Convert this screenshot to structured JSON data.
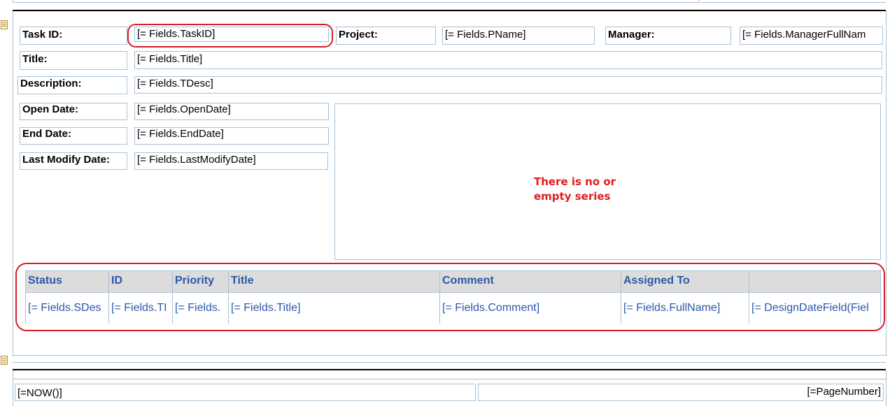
{
  "fields": {
    "task_id_label": "Task ID:",
    "task_id_value": "[= Fields.TaskID]",
    "project_label": "Project:",
    "project_value": "[= Fields.PName]",
    "manager_label": "Manager:",
    "manager_value": "[= Fields.ManagerFullNam",
    "title_label": "Title:",
    "title_value": "[= Fields.Title]",
    "description_label": "Description:",
    "description_value": "[= Fields.TDesc]",
    "open_date_label": "Open Date:",
    "open_date_value": "[= Fields.OpenDate]",
    "end_date_label": "End Date:",
    "end_date_value": "[= Fields.EndDate]",
    "last_modify_label": "Last Modify Date:",
    "last_modify_value": "[= Fields.LastModifyDate]"
  },
  "chart_placeholder": {
    "line1": "There is no or",
    "line2": "empty series"
  },
  "table": {
    "headers": [
      "Status",
      "ID",
      "Priority",
      "Title",
      "Comment",
      "Assigned To",
      ""
    ],
    "row": [
      "[= Fields.SDes",
      "[= Fields.TI",
      "[= Fields.",
      "[= Fields.Title]",
      "[= Fields.Comment]",
      "[= Fields.FullName]",
      "[= DesignDateField(Fiel"
    ]
  },
  "footer": {
    "now": "[=NOW()]",
    "page_number": "[=PageNumber]"
  },
  "colors": {
    "annotation_red": "#d21f2c",
    "table_text": "#2c57a9",
    "message_red": "#e41b1b",
    "border": "#a9bfd6",
    "header_bg": "#dcdcdc"
  },
  "icons": [
    "report-section-icon",
    "page-section-icon"
  ]
}
